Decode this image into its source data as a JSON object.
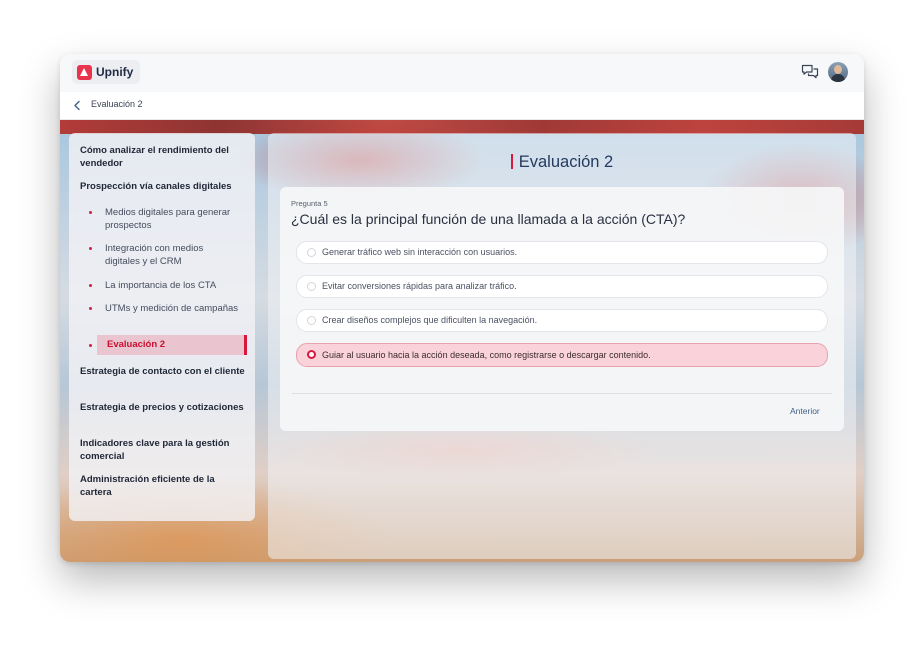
{
  "app": {
    "logo_text": "Upnify"
  },
  "header": {
    "chat_icon": "chat-bubbles-icon",
    "avatar": "user-avatar"
  },
  "breadcrumb": {
    "title": "Evaluación 2"
  },
  "sidebar": {
    "sections": [
      {
        "label": "Cómo analizar el rendimiento del vendedor"
      },
      {
        "label": "Prospección vía canales digitales"
      },
      {
        "label": "Estrategia de contacto con el cliente"
      },
      {
        "label": "Estrategia de precios y cotizaciones"
      },
      {
        "label": "Indicadores clave para la gestión comercial"
      },
      {
        "label": "Administración eficiente de la cartera"
      }
    ],
    "subitems": [
      {
        "label": "Medios digitales para generar prospectos"
      },
      {
        "label": "Integración con medios digitales y el CRM"
      },
      {
        "label": "La importancia de los CTA"
      },
      {
        "label": "UTMs y medición de campañas"
      },
      {
        "label": "Evaluación 2",
        "active": true
      }
    ]
  },
  "main": {
    "title": "Evaluación 2",
    "question": {
      "label": "Pregunta 5",
      "text": "¿Cuál es la principal función de una llamada a la acción (CTA)?",
      "options": [
        {
          "label": "Generar tráfico web sin interacción con usuarios.",
          "selected": false
        },
        {
          "label": "Evitar conversiones rápidas para analizar tráfico.",
          "selected": false
        },
        {
          "label": "Crear diseños complejos que dificulten la navegación.",
          "selected": false
        },
        {
          "label": "Guiar al usuario hacia la acción deseada, como registrarse o descargar contenido.",
          "selected": true
        }
      ]
    },
    "prev_label": "Anterior"
  },
  "colors": {
    "accent": "#d8183c",
    "selected_bg": "#f9d3d9",
    "title": "#243a5e"
  }
}
